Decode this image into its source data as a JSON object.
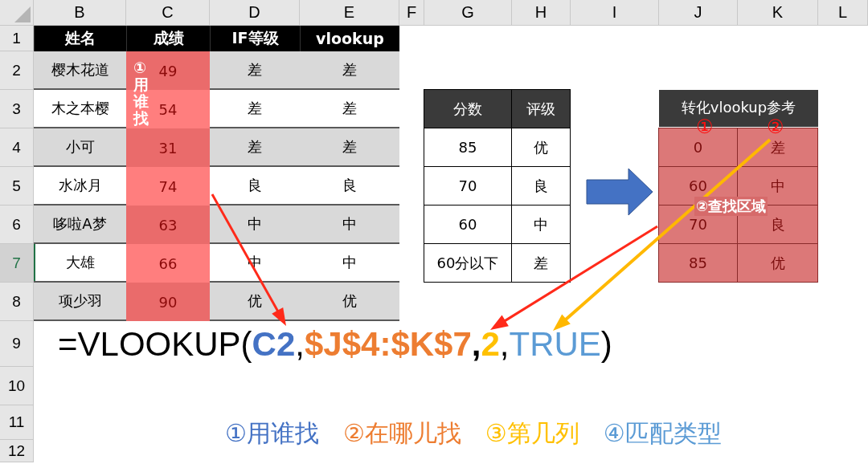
{
  "column_headers": [
    "B",
    "C",
    "D",
    "E",
    "F",
    "G",
    "H",
    "I",
    "J",
    "K",
    "L"
  ],
  "row_headers": [
    {
      "label": "1",
      "selected": false
    },
    {
      "label": "2",
      "selected": false
    },
    {
      "label": "3",
      "selected": false
    },
    {
      "label": "4",
      "selected": false
    },
    {
      "label": "5",
      "selected": false
    },
    {
      "label": "6",
      "selected": false
    },
    {
      "label": "7",
      "selected": true
    },
    {
      "label": "8",
      "selected": false
    },
    {
      "label": "9",
      "selected": false
    },
    {
      "label": "10",
      "selected": false
    },
    {
      "label": "11",
      "selected": false
    },
    {
      "label": "12",
      "selected": false
    }
  ],
  "score_table": {
    "columns": [
      {
        "label": "姓名",
        "highlighted": false
      },
      {
        "label": "成绩",
        "highlighted": true
      },
      {
        "label": "IF等级",
        "highlighted": false
      },
      {
        "label": "vlookup",
        "highlighted": false
      }
    ],
    "rows": [
      {
        "shaded": true,
        "cells": [
          "樱木花道",
          "49",
          "差",
          "差"
        ]
      },
      {
        "shaded": false,
        "cells": [
          "木之本樱",
          "54",
          "差",
          "差"
        ]
      },
      {
        "shaded": true,
        "cells": [
          "小可",
          "31",
          "差",
          "差"
        ]
      },
      {
        "shaded": false,
        "cells": [
          "水冰月",
          "74",
          "良",
          "良"
        ]
      },
      {
        "shaded": true,
        "cells": [
          "哆啦A梦",
          "63",
          "中",
          "中"
        ]
      },
      {
        "shaded": false,
        "cells": [
          "大雄",
          "66",
          "中",
          "中"
        ]
      },
      {
        "shaded": true,
        "cells": [
          "项少羽",
          "90",
          "优",
          "优"
        ]
      }
    ],
    "highlight_label": "①用谁找"
  },
  "grade_table": {
    "columns": [
      "分数",
      "评级"
    ],
    "rows": [
      [
        "85",
        "优"
      ],
      [
        "70",
        "良"
      ],
      [
        "60",
        "中"
      ],
      [
        "60分以下",
        "差"
      ]
    ]
  },
  "lookup_table": {
    "title": "转化vlookup参考",
    "markers": [
      "①",
      "②"
    ],
    "rows": [
      [
        "0",
        "差"
      ],
      [
        "60",
        "中"
      ],
      [
        "70",
        "良"
      ],
      [
        "85",
        "优"
      ]
    ],
    "area_label": "②查找区域"
  },
  "formula": [
    {
      "text": "=VLOOKUP(",
      "color": "#000000",
      "bold": false
    },
    {
      "text": "C2",
      "color": "#4472c4",
      "bold": true
    },
    {
      "text": ",",
      "color": "#000000",
      "bold": false
    },
    {
      "text": "$J$4:$K$7",
      "color": "#ed7d31",
      "bold": true
    },
    {
      "text": ",",
      "color": "#000000",
      "bold": true
    },
    {
      "text": "2",
      "color": "#ffc000",
      "bold": true
    },
    {
      "text": ",",
      "color": "#000000",
      "bold": false
    },
    {
      "text": "TRUE",
      "color": "#5b9bd5",
      "bold": false
    },
    {
      "text": ")",
      "color": "#000000",
      "bold": false
    }
  ],
  "legend": [
    {
      "text": "①用谁找",
      "color": "#4472c4"
    },
    {
      "text": "②在哪儿找",
      "color": "#ed7d31"
    },
    {
      "text": "③第几列",
      "color": "#ffc000"
    },
    {
      "text": "④匹配类型",
      "color": "#5b9bd5"
    }
  ]
}
